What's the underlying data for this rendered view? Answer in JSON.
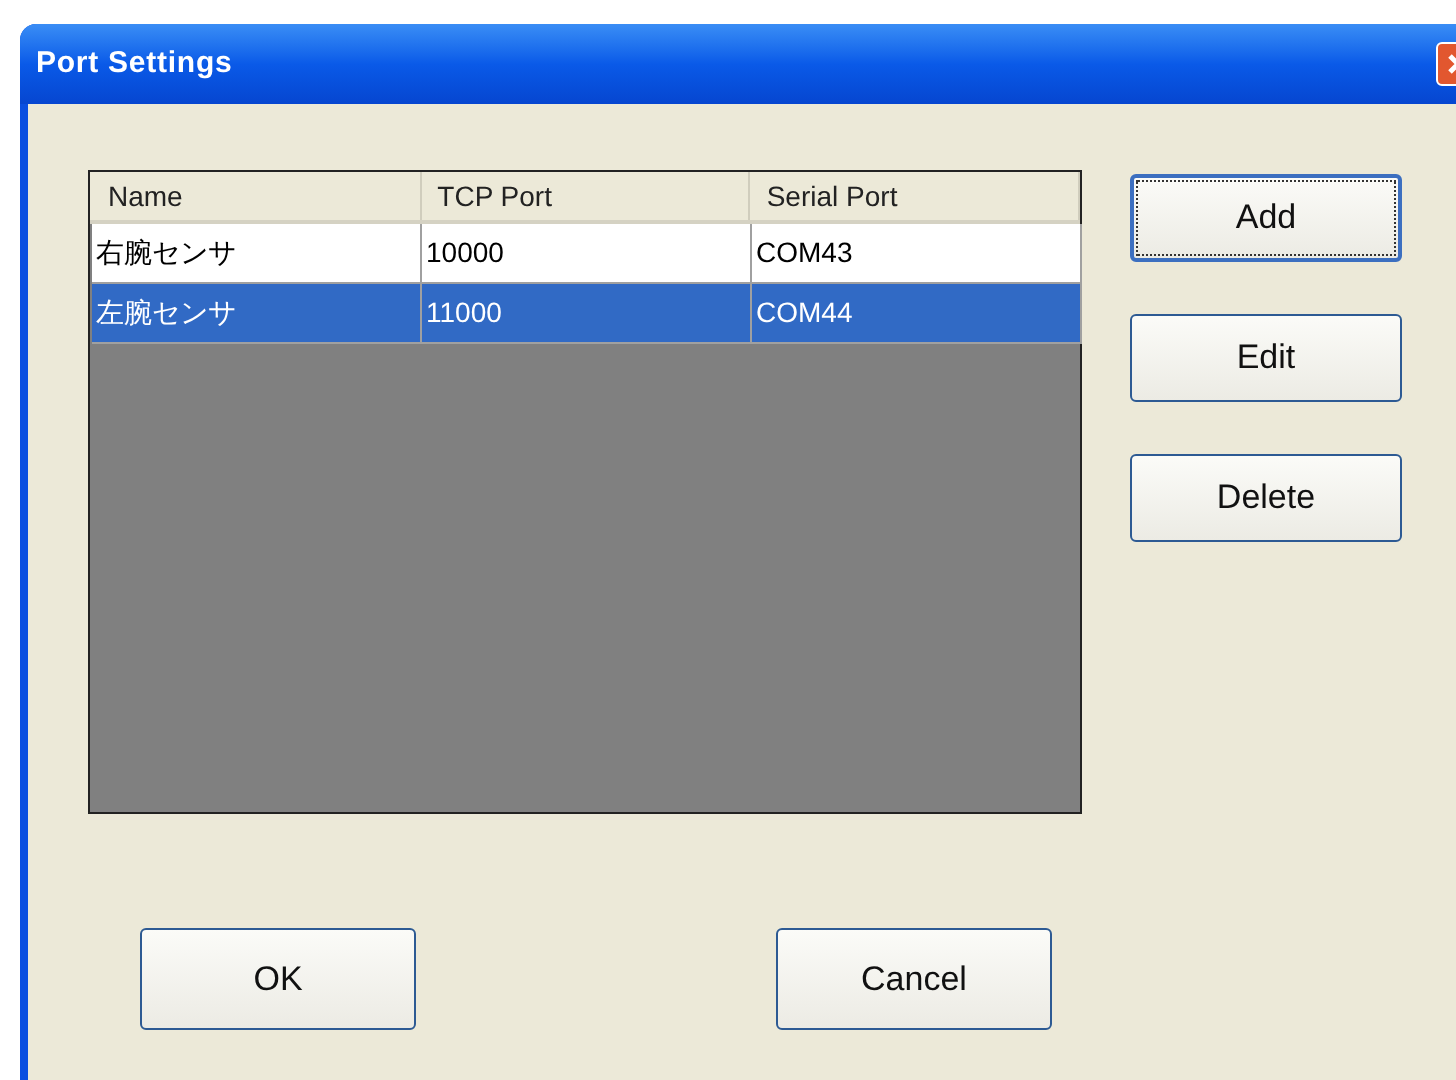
{
  "window": {
    "title": "Port Settings"
  },
  "table": {
    "columns": [
      "Name",
      "TCP Port",
      "Serial Port"
    ],
    "rows": [
      {
        "cells": [
          "右腕センサ",
          "10000",
          "COM43"
        ],
        "selected": false
      },
      {
        "cells": [
          "左腕センサ",
          "11000",
          "COM44"
        ],
        "selected": true
      }
    ]
  },
  "side_buttons": [
    {
      "label": "Add",
      "focused": true
    },
    {
      "label": "Edit",
      "focused": false
    },
    {
      "label": "Delete",
      "focused": false
    }
  ],
  "bottom_buttons": [
    {
      "label": "OK",
      "focused": false
    },
    {
      "label": "Cancel",
      "focused": false
    }
  ]
}
